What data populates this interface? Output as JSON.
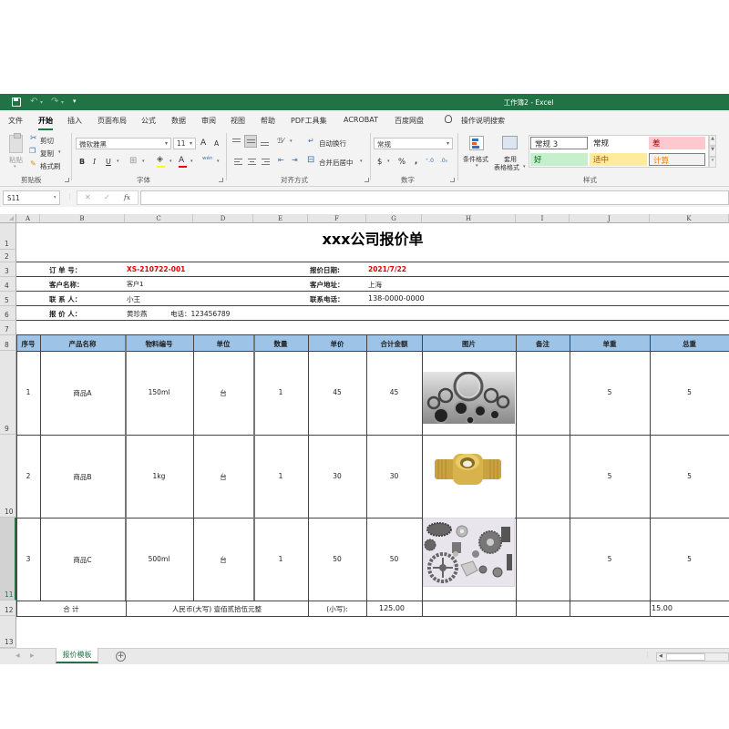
{
  "titlebar": {
    "title": "工作簿2  -  Excel",
    "undo_icon": "undo-icon",
    "redo_icon": "redo-icon",
    "save_icon": "save-icon",
    "customize": "▾"
  },
  "menu": {
    "tabs": [
      "文件",
      "开始",
      "插入",
      "页面布局",
      "公式",
      "数据",
      "审阅",
      "视图",
      "帮助",
      "PDF工具集",
      "ACROBAT",
      "百度网盘"
    ],
    "active_tab": "开始",
    "search_label": "操作说明搜索"
  },
  "ribbon": {
    "clipboard": {
      "paste": "粘贴",
      "cut": "剪切",
      "copy": "复制",
      "format_painter": "格式刷",
      "group": "剪贴板"
    },
    "font": {
      "name": "微软雅黑",
      "size": "11",
      "grow": "A",
      "shrink": "A",
      "bold": "B",
      "italic": "I",
      "underline": "U",
      "group": "字体",
      "fill_color": "#ffff00",
      "font_color": "#ff0000",
      "wen": "wén"
    },
    "alignment": {
      "wrap": "自动换行",
      "merge": "合并后居中",
      "group": "对齐方式"
    },
    "number": {
      "format": "常规",
      "currency": "$",
      "percent": "%",
      "comma": ",",
      "inc": "⁺.0",
      "dec": ".0₀",
      "group": "数字"
    },
    "styles": {
      "conditional": "条件格式",
      "table_line1": "套用",
      "table_line2": "表格格式",
      "group": "样式",
      "cells": [
        {
          "label": "常规 3",
          "bg": "#ffffff",
          "fg": "#333333",
          "border": "#7f7f7f"
        },
        {
          "label": "常规",
          "bg": "#ffffff",
          "fg": "#222222",
          "border": ""
        },
        {
          "label": "差",
          "bg": "#ffc7ce",
          "fg": "#9c0006",
          "border": ""
        },
        {
          "label": "好",
          "bg": "#c6efce",
          "fg": "#006100",
          "border": ""
        },
        {
          "label": "适中",
          "bg": "#ffeb9c",
          "fg": "#9c5700",
          "border": ""
        },
        {
          "label": "计算",
          "bg": "#f2f2f2",
          "fg": "#fa7d00",
          "border": "#7f7f7f"
        }
      ]
    }
  },
  "formula_bar": {
    "name_box": "S11",
    "cancel": "✕",
    "enter": "✓",
    "fx": "fx",
    "value": ""
  },
  "columns": [
    "A",
    "B",
    "C",
    "D",
    "E",
    "F",
    "G",
    "H",
    "I",
    "J",
    "K"
  ],
  "rows": [
    "1",
    "2",
    "3",
    "4",
    "5",
    "6",
    "7",
    "8",
    "9",
    "10",
    "11",
    "12",
    "13"
  ],
  "sheet": {
    "title": "xxx公司报价单",
    "info": {
      "order_no_label": "订  单  号：",
      "order_no": "XS-210722-001",
      "date_label": "报价日期:",
      "date": "2021/7/22",
      "customer_label": "客户名称：",
      "customer": "客户1",
      "address_label": "客户地址：",
      "address": "上海",
      "contact_label": "联  系  人：",
      "contact": "小王",
      "phone_label": "联系电话：",
      "phone": "138-0000-0000",
      "quoter_label": "报  价  人：",
      "quoter": "黄珍燕",
      "quoter_phone": "电话：123456789"
    },
    "headers": [
      "序号",
      "产品名称",
      "物料编号",
      "单位",
      "数量",
      "单价",
      "合计金额",
      "图片",
      "备注",
      "单重",
      "总重"
    ],
    "header_bg": "#9dc3e6",
    "items": [
      {
        "no": "1",
        "name": "商品A",
        "code": "150ml",
        "unit": "台",
        "qty": "1",
        "price": "45",
        "amount": "45",
        "image": "bearings-image",
        "note": "",
        "unit_weight": "5",
        "total_weight": "5"
      },
      {
        "no": "2",
        "name": "商品B",
        "code": "1kg",
        "unit": "台",
        "qty": "1",
        "price": "30",
        "amount": "30",
        "image": "brass-fitting-image",
        "note": "",
        "unit_weight": "5",
        "total_weight": "5"
      },
      {
        "no": "3",
        "name": "商品C",
        "code": "500ml",
        "unit": "台",
        "qty": "1",
        "price": "50",
        "amount": "50",
        "image": "gears-image",
        "note": "",
        "unit_weight": "5",
        "total_weight": "5"
      }
    ],
    "total": {
      "label": "合    计",
      "uppercase": "人民币(大写) 壹佰贰拾伍元整",
      "lowercase_label": "(小写):",
      "amount": "125.00",
      "weight": "15.00"
    }
  },
  "sheet_tabs": {
    "tabs": [
      "报价模板"
    ],
    "active": "报价模板",
    "add": "+"
  }
}
